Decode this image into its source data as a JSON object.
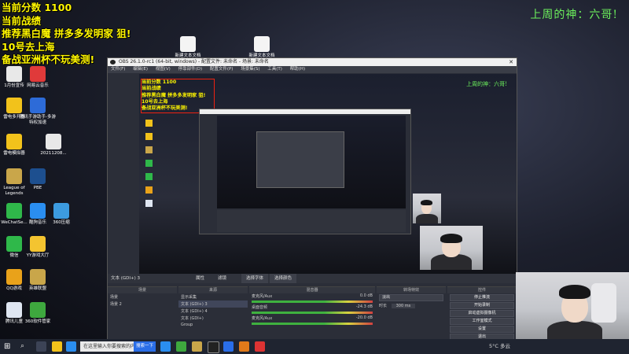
{
  "overlay": {
    "lines": [
      "当前分数 1100",
      "当前战绩",
      "推荐黑白魔 拼多多发明家 狙!",
      "10号去上海",
      "备战亚洲杯不玩美测!"
    ],
    "top_right": "上周的神：六哥!"
  },
  "desktop_icons": [
    {
      "label": "1月份宣传",
      "color": "#e8e8e8"
    },
    {
      "label": "网易云音乐",
      "color": "#e03a3a"
    },
    {
      "label": "雷电多开器",
      "color": "#f2c21b"
    },
    {
      "label": "腾讯手游助手-多游特权加速",
      "color": "#2d6bd8"
    },
    {
      "label": "雷电模拟器",
      "color": "#f2c21b"
    },
    {
      "label": "20211208...",
      "color": "#e8e8e8"
    },
    {
      "label": "League of Legends",
      "color": "#c9a64a"
    },
    {
      "label": "PBE",
      "color": "#1d4f8f"
    },
    {
      "label": "WeChatSe...",
      "color": "#2fb84a"
    },
    {
      "label": "酷狗音乐",
      "color": "#2a8ef0"
    },
    {
      "label": "360压缩",
      "color": "#3c9be0"
    },
    {
      "label": "微信",
      "color": "#2fb84a"
    },
    {
      "label": "YY游戏大厅",
      "color": "#f4c430"
    },
    {
      "label": "QQ游戏",
      "color": "#e9a21a"
    },
    {
      "label": "英雄联盟",
      "color": "#c9a64a"
    },
    {
      "label": "腾讯儿童",
      "color": "#dfe6f2"
    },
    {
      "label": "360软件管家",
      "color": "#3ea83e"
    }
  ],
  "top_desktop_icons": [
    {
      "label": "新建文本文档"
    },
    {
      "label": "新建文本文档"
    }
  ],
  "obs": {
    "title": "OBS 26.1.0-rc1 (64-bit, windows) - 配置文件: 未命名 - 场景: 未命名",
    "menu": [
      "文件(F)",
      "编辑(E)",
      "视图(V)",
      "停靠部件(D)",
      "配置文件(P)",
      "场景集(S)",
      "工具(T)",
      "帮助(H)"
    ],
    "source_label": "文本 (GDI+) 3",
    "toolbar": [
      "属性",
      "滤镜",
      "选择字体",
      "选择颜色"
    ],
    "docks": {
      "scenes": {
        "title": "场景",
        "items": [
          "场景",
          "场景 2"
        ]
      },
      "sources": {
        "title": "来源",
        "items": [
          "显示采集",
          "文本 (GDI+) 3",
          "文本 (GDI+) 4",
          "文本 (GDI+)",
          "Group",
          "",
          ""
        ]
      },
      "mixer": {
        "title": "混音器",
        "channels": [
          {
            "name": "麦克风/Aux",
            "db": "0.0 dB"
          },
          {
            "name": "桌面音频",
            "db": "-24.3 dB"
          },
          {
            "name": "麦克风/Aux",
            "db": "-20.0 dB"
          }
        ]
      },
      "transitions": {
        "title": "转场特效",
        "selected": "淡出",
        "duration_label": "时长",
        "duration_value": "300 ms"
      },
      "controls": {
        "title": "控件",
        "buttons": [
          "停止推流",
          "开始录制",
          "启动虚拟摄像机",
          "工作室模式",
          "设置",
          "退出"
        ]
      }
    }
  },
  "taskbar": {
    "search_placeholder": "在这里输入你要搜索的内容",
    "search_button": "搜索一下",
    "weather": "5°C 多云"
  },
  "colors": {
    "overlay_yellow": "#fff600",
    "overlay_green": "#6cf05c",
    "obs_bg": "#2b2e38"
  }
}
